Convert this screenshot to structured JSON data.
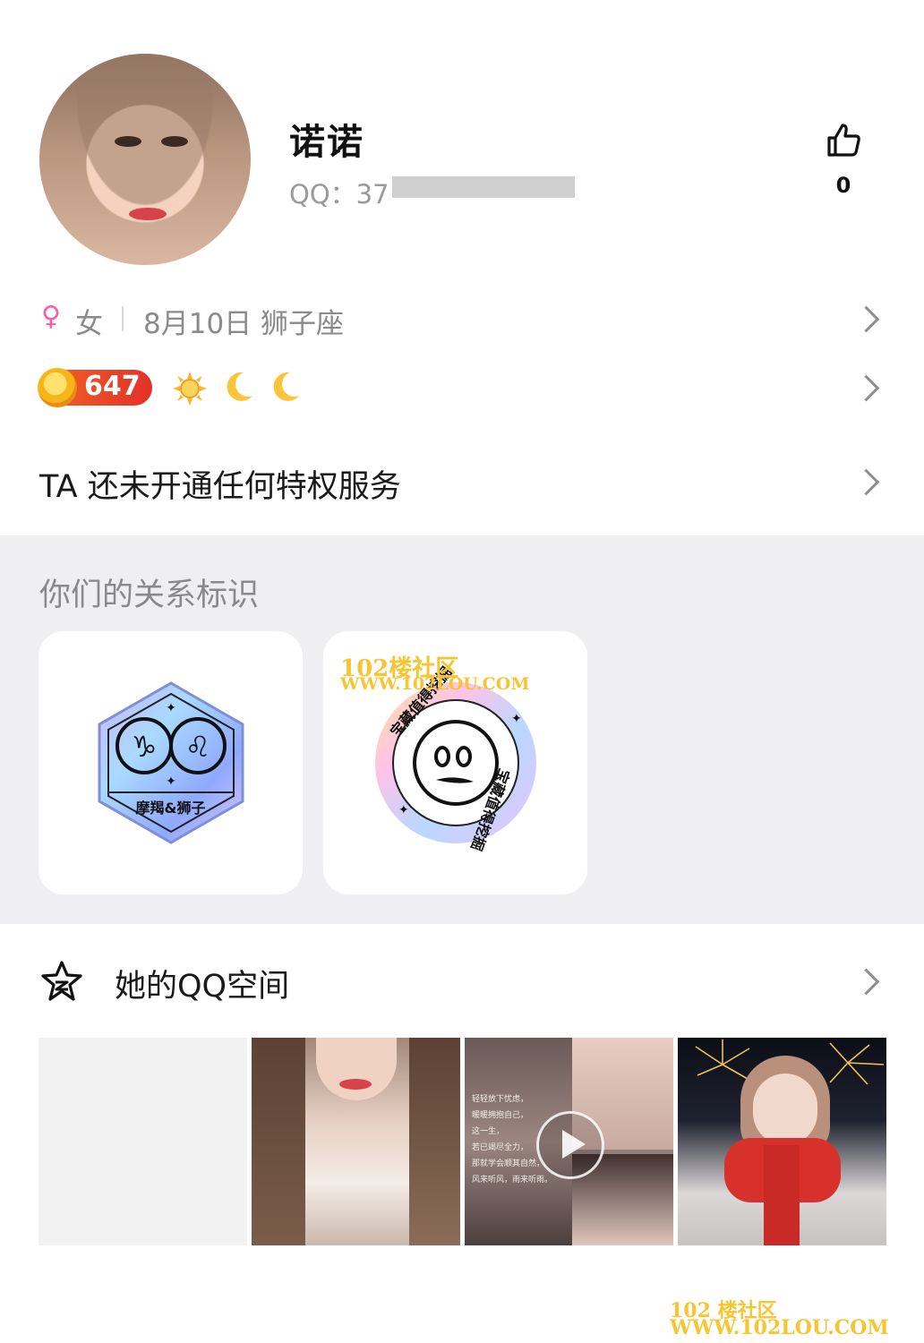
{
  "profile": {
    "name": "诺诺",
    "qq_label": "QQ：37",
    "likes": "0"
  },
  "info": {
    "gender_symbol": "♀",
    "gender": "女",
    "birthday": "8月10日 狮子座",
    "level": "647"
  },
  "privilege": {
    "text": "TA 还未开通任何特权服务"
  },
  "relationship": {
    "title": "你们的关系标识",
    "badges": [
      {
        "label": "摩羯&狮子",
        "symbols": "♑ ♌"
      },
      {
        "label": "宝藏值得挖掘"
      }
    ]
  },
  "qzone": {
    "title": "她的QQ空间",
    "video_caption": [
      "轻轻放下忧虑，",
      "暖暖拥抱自己，",
      "这一生，",
      "若已竭尽全力，",
      "那就学会顺其自然，",
      "风来听风，雨来听雨。"
    ]
  },
  "watermarks": {
    "line1": "102楼社区",
    "line2": "WWW.102LOU.COM",
    "line3": "102 楼社区",
    "line4": "WWW.102LOU.COM"
  },
  "colors": {
    "accent_pink": "#ff5aa5",
    "level_badge": "#e3312a",
    "section_gray": "#efeff2"
  }
}
